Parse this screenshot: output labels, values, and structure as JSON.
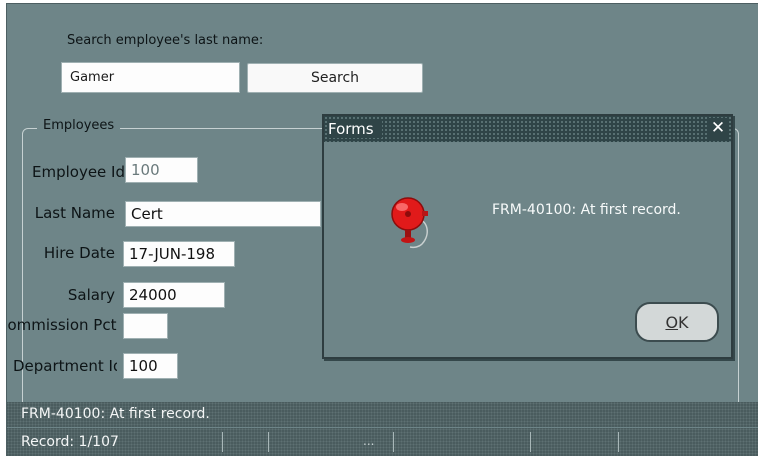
{
  "search": {
    "label": "Search employee's last name:",
    "value": "Gamer",
    "button_label": "Search"
  },
  "employees": {
    "group_title": "Employees",
    "fields": {
      "employee_id": {
        "label": "Employee Id",
        "value": "100"
      },
      "last_name": {
        "label": "Last Name",
        "value": "Cert"
      },
      "hire_date": {
        "label": "Hire Date",
        "value": "17-JUN-198"
      },
      "salary": {
        "label": "Salary",
        "value": "24000"
      },
      "commission": {
        "label": "Commission Pct",
        "value": ""
      },
      "department_id": {
        "label": "Department Id",
        "value": "100"
      }
    }
  },
  "dialog": {
    "title": "Forms",
    "message": "FRM-40100: At first record.",
    "ok_label": "OK",
    "icon": "alarm-bell-icon"
  },
  "status_bar": {
    "message": "FRM-40100: At first record.",
    "record": "Record: 1/107",
    "ellipsis": "..."
  },
  "colors": {
    "background": "#6e8588",
    "dialog_titlebar": "#2f4447",
    "status_bar": "#4a5c5e"
  }
}
